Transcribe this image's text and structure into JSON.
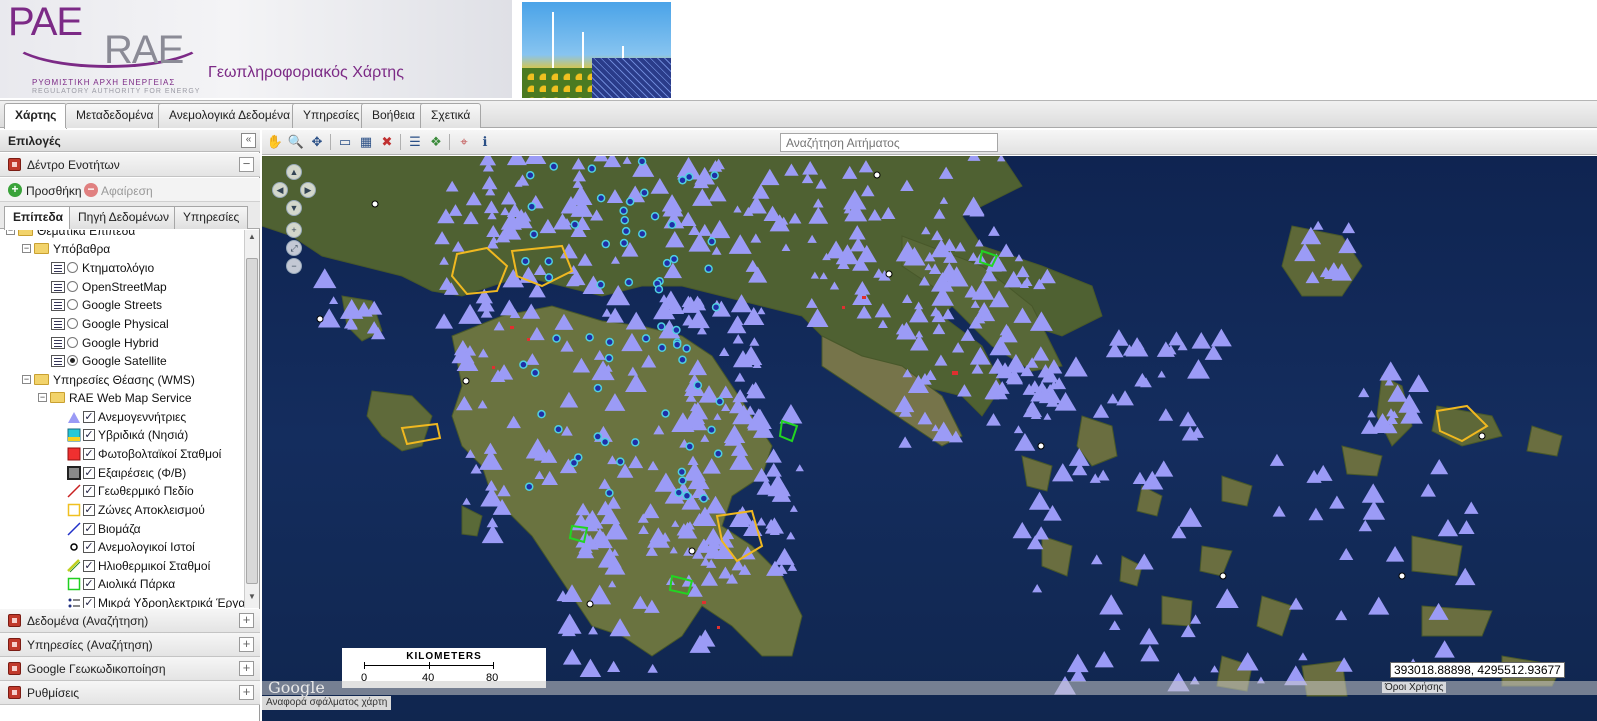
{
  "header": {
    "logo_primary": "PAE",
    "logo_secondary": "RAE",
    "logo_sub_gr": "ΡΥΘΜΙΣΤΙΚΗ ΑΡΧΗ ΕΝΕΡΓΕΙΑΣ",
    "logo_sub_en": "REGULATORY AUTHORITY FOR ENERGY",
    "title": "Γεωπληροφοριακός Χάρτης"
  },
  "tabs": [
    {
      "label": "Χάρτης",
      "active": true
    },
    {
      "label": "Μεταδεδομένα",
      "active": false
    },
    {
      "label": "Ανεμολογικά Δεδομένα",
      "active": false
    },
    {
      "label": "Υπηρεσίες",
      "active": false
    },
    {
      "label": "Βοήθεια",
      "active": false
    },
    {
      "label": "Σχετικά",
      "active": false
    }
  ],
  "sidebar": {
    "title": "Επιλογές",
    "collapse_icon": "double-chevron-left-icon",
    "tree_section": "Δέντρο Ενοτήτων",
    "add_label": "Προσθήκη",
    "remove_label": "Αφαίρεση",
    "subtabs": [
      {
        "label": "Επίπεδα",
        "active": true
      },
      {
        "label": "Πηγή Δεδομένων",
        "active": false
      },
      {
        "label": "Υπηρεσίες",
        "active": false
      }
    ],
    "tree": {
      "partial_top": "Θεματικά Επίπεδα",
      "base_folder": "Υπόβαθρα",
      "base_layers": [
        {
          "label": "Κτηματολόγιο",
          "selected": false
        },
        {
          "label": "OpenStreetMap",
          "selected": false
        },
        {
          "label": "Google Streets",
          "selected": false
        },
        {
          "label": "Google Physical",
          "selected": false
        },
        {
          "label": "Google Hybrid",
          "selected": false
        },
        {
          "label": "Google Satellite",
          "selected": true
        }
      ],
      "wms_folder": "Υπηρεσίες Θέασης (WMS)",
      "rae_folder": "RAE Web Map Service",
      "overlays": [
        {
          "label": "Ανεμογεννήτριες",
          "checked": true,
          "legend": "purple-triangle"
        },
        {
          "label": "Υβριδικά (Νησιά)",
          "checked": true,
          "legend": "cyan-square"
        },
        {
          "label": "Φωτοβολταϊκοί Σταθμοί",
          "checked": true,
          "legend": "red-square"
        },
        {
          "label": "Εξαιρέσεις (Φ/Β)",
          "checked": true,
          "legend": "gray-square"
        },
        {
          "label": "Γεωθερμικό Πεδίο",
          "checked": true,
          "legend": "red-line"
        },
        {
          "label": "Ζώνες Αποκλεισμού",
          "checked": true,
          "legend": "yellow-outline"
        },
        {
          "label": "Βιομάζα",
          "checked": true,
          "legend": "blue-line"
        },
        {
          "label": "Ανεμολογικοί Ιστοί",
          "checked": true,
          "legend": "black-dot"
        },
        {
          "label": "Ηλιοθερμικοί Σταθμοί",
          "checked": true,
          "legend": "yellow-green-line"
        },
        {
          "label": "Αιολικά Πάρκα",
          "checked": true,
          "legend": "green-outline"
        },
        {
          "label": "Μικρά Υδροηλεκτρικά Έργα",
          "checked": true,
          "legend": "hydro-icon"
        }
      ]
    },
    "accordions": [
      "Δεδομένα (Αναζήτηση)",
      "Υπηρεσίες (Αναζήτηση)",
      "Google Γεωκωδικοποίηση",
      "Ρυθμίσεις"
    ]
  },
  "map_toolbar": {
    "search_placeholder": "Αναζήτηση Αιτήματος",
    "tools": [
      "pan-hand-icon",
      "zoom-box-icon",
      "full-extent-icon",
      "measure-icon",
      "table-icon",
      "clear-icon",
      "legend-icon",
      "layers-icon",
      "locate-icon",
      "info-icon"
    ]
  },
  "map": {
    "scale_title": "KILOMETERS",
    "scale_ticks": [
      "0",
      "40",
      "80"
    ],
    "coordinates": "393018.88898, 4295512.93677",
    "provider_logo": "Google",
    "terms": "Όροι Χρήσης",
    "report": "Αναφορά σφάλματος χάρτη"
  }
}
